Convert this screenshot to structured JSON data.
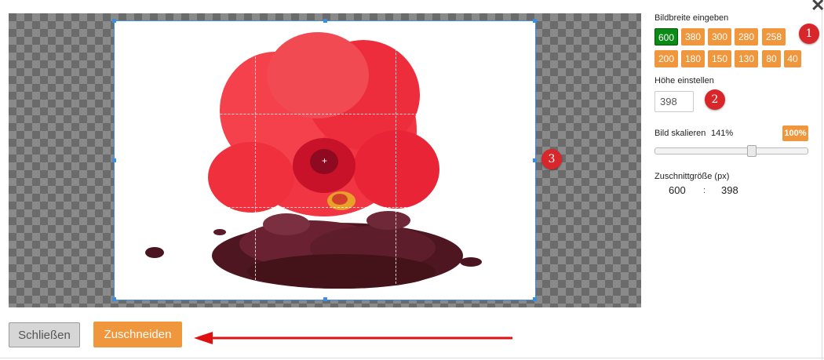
{
  "dialog": {
    "close_glyph": "✕"
  },
  "panel": {
    "width_label": "Bildbreite eingeben",
    "widths": [
      "600",
      "380",
      "300",
      "280",
      "258",
      "200",
      "180",
      "150",
      "130",
      "80",
      "40"
    ],
    "active_width": "600",
    "height_label": "Höhe einstellen",
    "height_value": "398",
    "scale_label": "Bild skalieren",
    "scale_value": "141%",
    "reset_label": "100%",
    "scale_fraction": 0.64,
    "cropsize_label": "Zuschnittgröße (px)",
    "crop_width": "600",
    "crop_separator": ":",
    "crop_height": "398"
  },
  "badges": {
    "one": "1",
    "two": "2",
    "three": "3"
  },
  "buttons": {
    "close": "Schließen",
    "crop": "Zuschneiden"
  },
  "colors": {
    "accent": "#f0963c",
    "active": "#0b8a16",
    "badge": "#d9262a",
    "crop_border": "#3b8fe0",
    "arrow": "#e01010"
  },
  "image": {
    "subject": "hibiscus-flower-with-dried-petals"
  }
}
